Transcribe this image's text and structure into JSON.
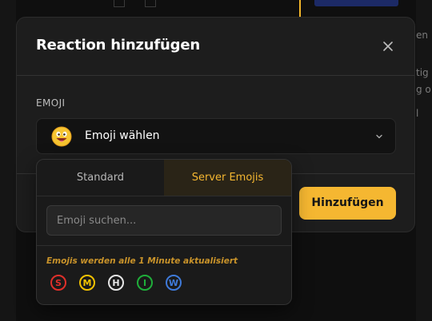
{
  "modal": {
    "title": "Reaction hinzufügen",
    "close_icon": "close-icon",
    "field_label": "EMOJI",
    "select_label": "Emoji wählen",
    "select_icon": "smiley-face-icon",
    "add_button": "Hinzufügen"
  },
  "picker": {
    "tabs": [
      {
        "label": "Standard",
        "active": false
      },
      {
        "label": "Server Emojis",
        "active": true
      }
    ],
    "search_placeholder": "Emoji suchen...",
    "note": "Emojis werden alle 1 Minute aktualisiert",
    "emojis": [
      {
        "letter": "S",
        "color": "#e0302a"
      },
      {
        "letter": "M",
        "color": "#f2c200"
      },
      {
        "letter": "H",
        "color": "#e6e6e6"
      },
      {
        "letter": "I",
        "color": "#1fae3a"
      },
      {
        "letter": "W",
        "color": "#3f7ad9"
      }
    ]
  },
  "background": {
    "text_lines": [
      "en",
      "tig",
      "g o",
      "l"
    ]
  },
  "colors": {
    "accent": "#f5b731",
    "modal_bg": "#1d1d1d",
    "page_bg": "#0f0f0f"
  }
}
